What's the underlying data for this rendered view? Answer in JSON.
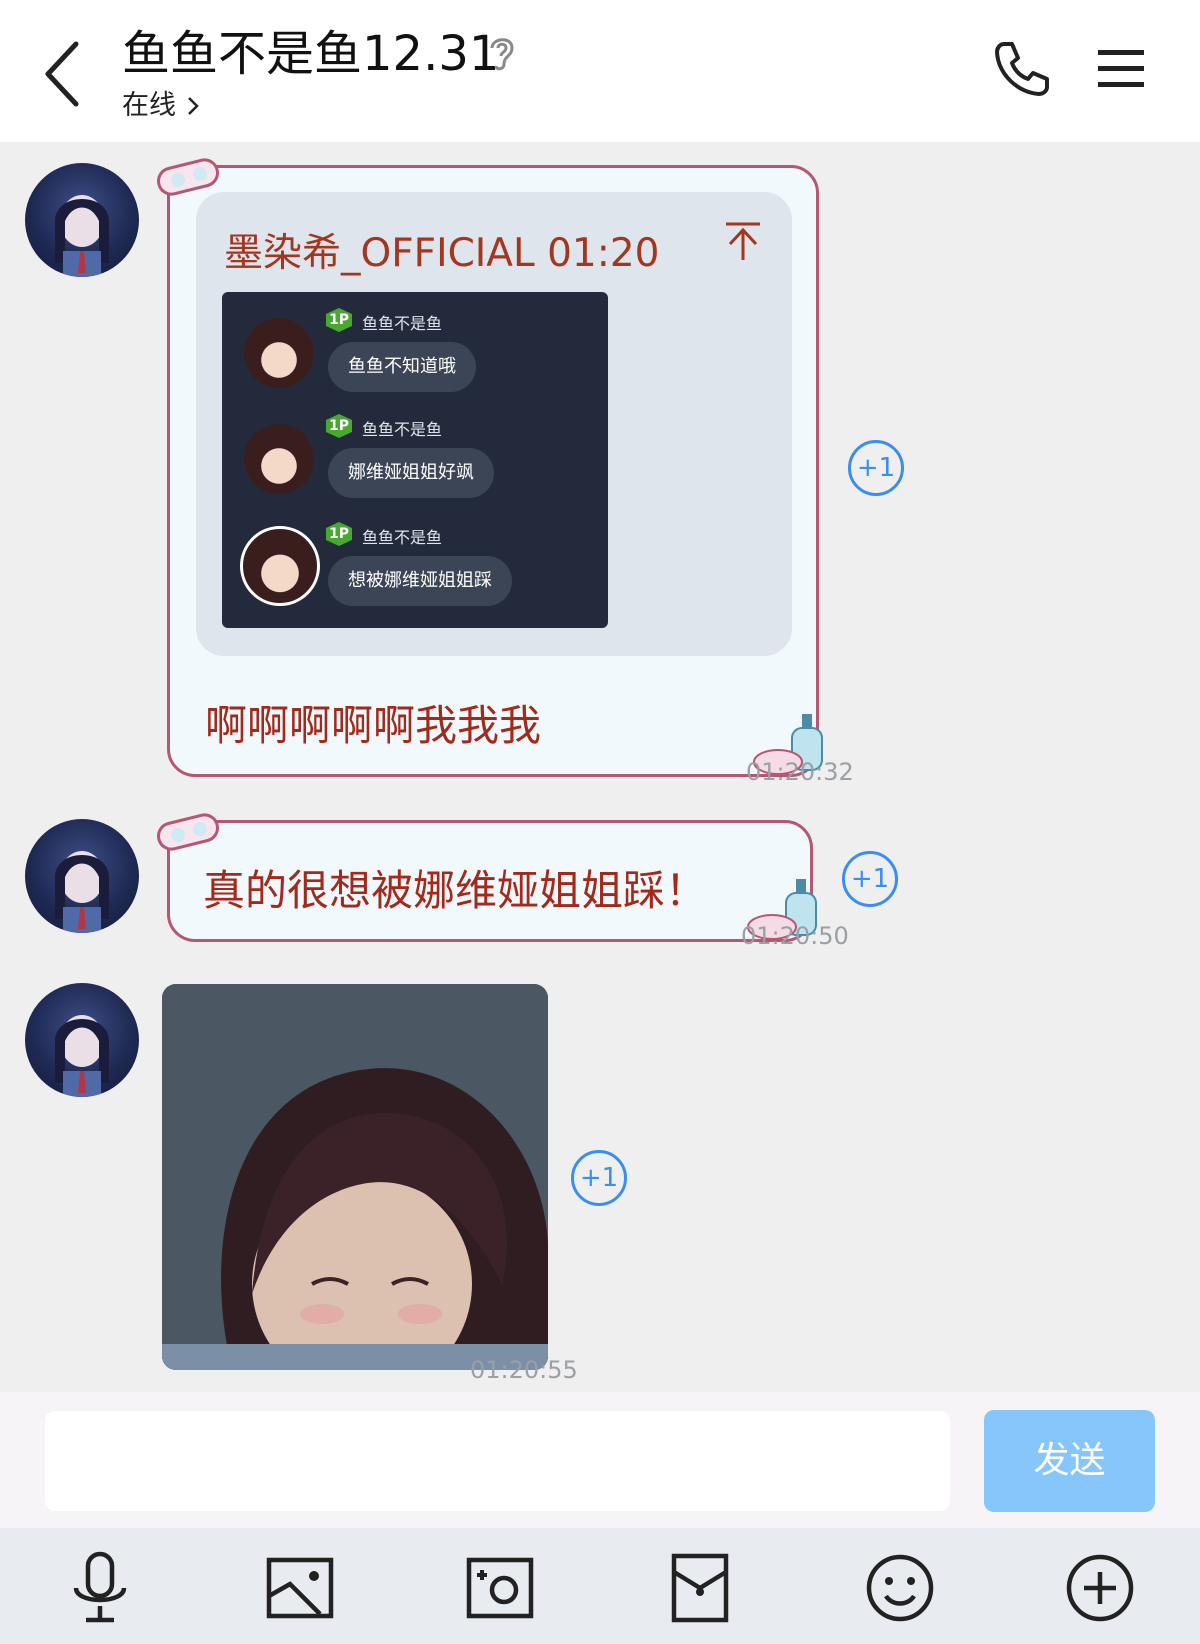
{
  "header": {
    "contact_name": "鱼鱼不是鱼12.31",
    "status": "在线"
  },
  "messages": [
    {
      "type": "quote_reply",
      "quote_author_time": "墨染希_OFFICIAL 01:20",
      "quoted_chat": [
        {
          "badge": "1P",
          "name": "鱼鱼不是鱼",
          "text": "鱼鱼不知道哦"
        },
        {
          "badge": "1P",
          "name": "鱼鱼不是鱼",
          "text": "娜维娅姐姐好飒"
        },
        {
          "badge": "1P",
          "name": "鱼鱼不是鱼",
          "text": "想被娜维娅姐姐踩"
        }
      ],
      "text": "啊啊啊啊啊我我我",
      "time": "01:20:32",
      "plus_one": "+1"
    },
    {
      "type": "text",
      "text": "真的很想被娜维娅姐姐踩！",
      "time": "01:20:50",
      "plus_one": "+1"
    },
    {
      "type": "image",
      "time": "01:20:55",
      "plus_one": "+1"
    }
  ],
  "composer": {
    "placeholder": "",
    "send_label": "发送"
  },
  "toolbar": [
    "mic-icon",
    "photo-icon",
    "camera-icon",
    "red-packet-icon",
    "emoji-icon",
    "plus-icon"
  ],
  "colors": {
    "accent_blue": "#3a8ef0",
    "send_button": "#87c6fb",
    "bubble_border": "#b55673",
    "message_text": "#a3291b"
  }
}
